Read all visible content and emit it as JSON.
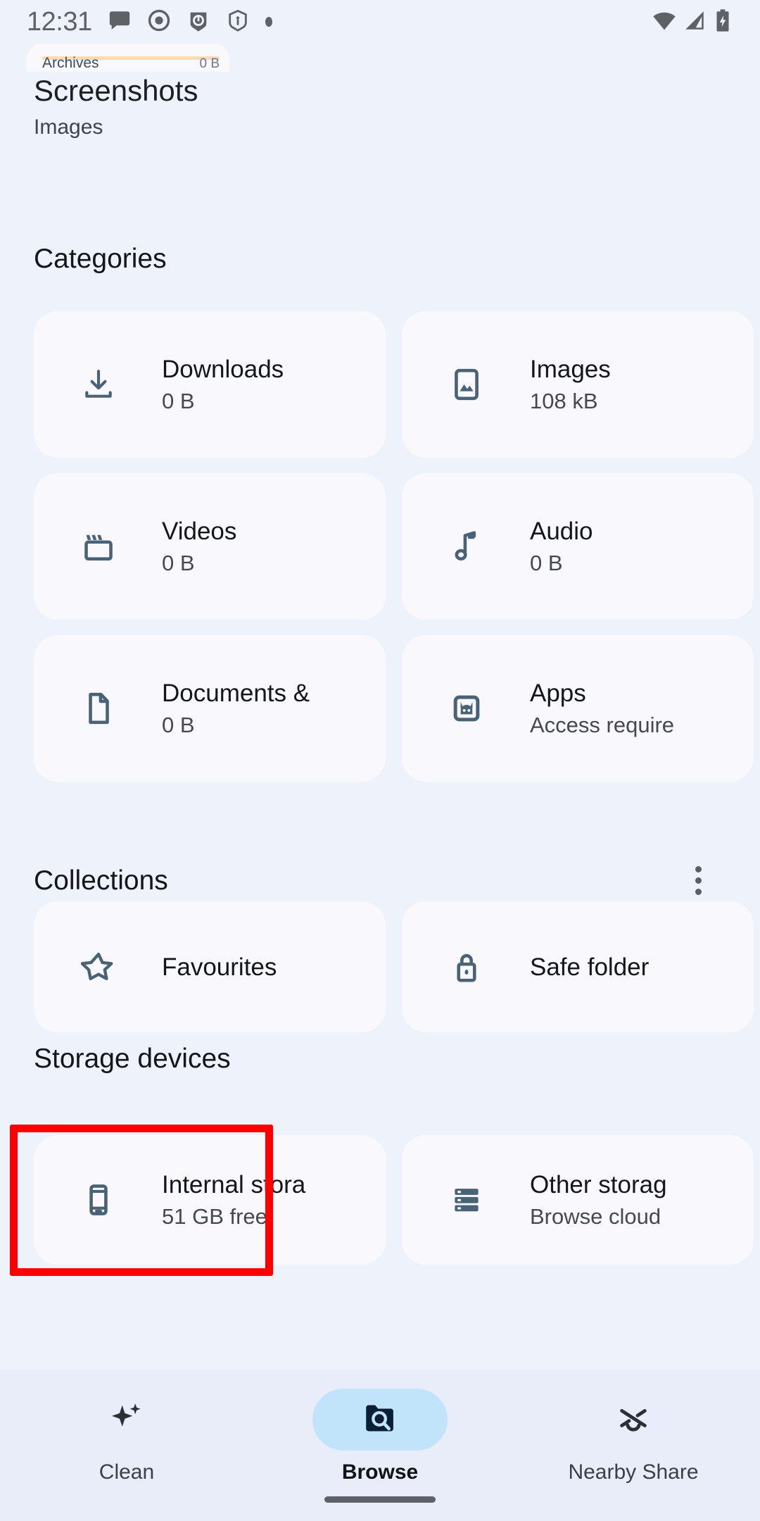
{
  "status_bar": {
    "time": "12:31",
    "left_icons": [
      "message-icon",
      "record-icon",
      "app-notification-icon",
      "shield-icon",
      "more-notifications-dot"
    ],
    "right_icons": [
      "wifi-icon",
      "cellular-signal-icon",
      "battery-charging-icon"
    ]
  },
  "peek_card": {
    "label": "Archives",
    "size": "0 B",
    "bar_color": "#fbdcae"
  },
  "header": {
    "title": "Screenshots",
    "subtitle": "Images"
  },
  "categories": {
    "section_title": "Categories",
    "items": [
      {
        "icon": "download-icon",
        "title": "Downloads",
        "sub": "0 B",
        "clipped": false
      },
      {
        "icon": "image-icon",
        "title": "Images",
        "sub": "108 kB",
        "clipped": false
      },
      {
        "icon": "video-icon",
        "title": "Videos",
        "sub": "0 B",
        "clipped": false
      },
      {
        "icon": "audio-icon",
        "title": "Audio",
        "sub": "0 B",
        "clipped": false
      },
      {
        "icon": "document-icon",
        "title": "Documents &",
        "sub": "0 B",
        "clipped": true
      },
      {
        "icon": "apps-icon",
        "title": "Apps",
        "sub": "Access require",
        "clipped": true
      }
    ]
  },
  "collections": {
    "section_title": "Collections",
    "overflow_icon": "more-vertical-icon",
    "items": [
      {
        "icon": "star-icon",
        "title": "Favourites"
      },
      {
        "icon": "lock-icon",
        "title": "Safe folder"
      }
    ]
  },
  "storage_devices": {
    "section_title": "Storage devices",
    "items": [
      {
        "icon": "phone-icon",
        "title": "Internal stora",
        "sub": "51 GB free",
        "highlighted": true,
        "clipped": true
      },
      {
        "icon": "server-icon",
        "title": "Other storag",
        "sub": "Browse cloud",
        "highlighted": false,
        "clipped": true
      }
    ]
  },
  "bottom_nav": {
    "items": [
      {
        "icon": "sparkle-icon",
        "label": "Clean",
        "active": false
      },
      {
        "icon": "folder-search-icon",
        "label": "Browse",
        "active": true
      },
      {
        "icon": "nearby-share-icon",
        "label": "Nearby Share",
        "active": false
      }
    ]
  },
  "colors": {
    "page_background": "#eef3fb",
    "card_background": "#f9f9fd",
    "nav_background": "#e8edf9",
    "icon_blue_gray": "#4a6276",
    "active_pill": "#c2e4fb",
    "highlight_red": "#ff0000",
    "text_primary": "#14161a",
    "text_secondary": "#45494f"
  }
}
